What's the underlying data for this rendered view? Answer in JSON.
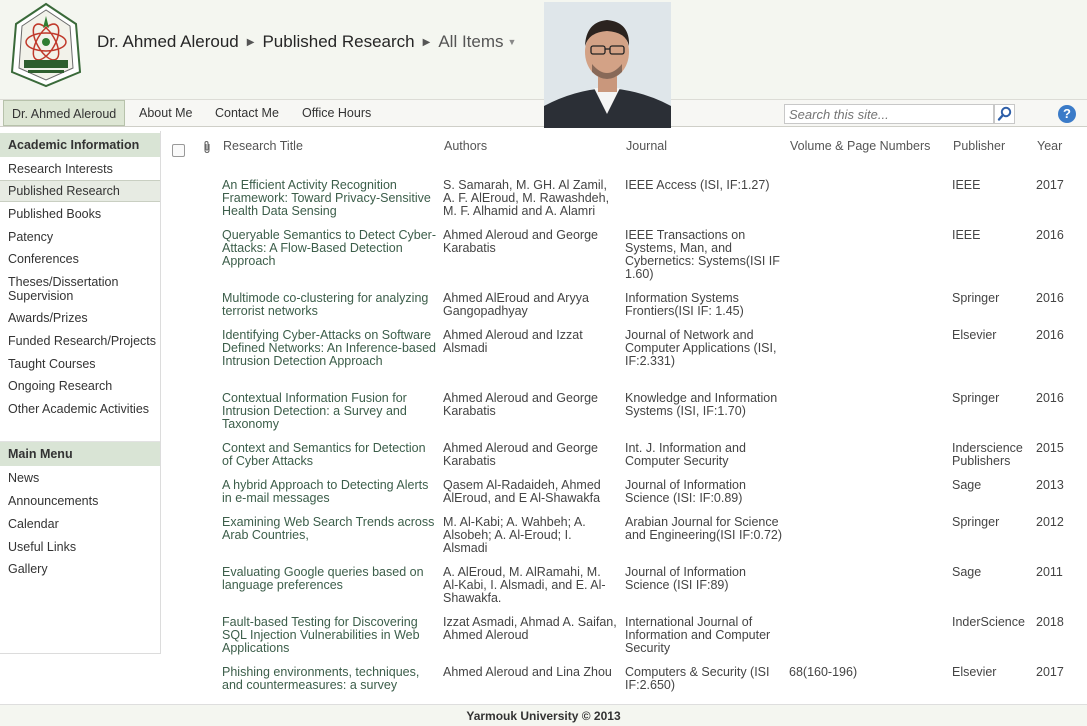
{
  "header": {
    "breadcrumb": [
      "Dr. Ahmed Aleroud",
      "Published Research",
      "All Items"
    ]
  },
  "topnav": {
    "items": [
      "Dr. Ahmed Aleroud",
      "About Me",
      "Contact Me",
      "Office Hours"
    ],
    "selected": "Dr. Ahmed Aleroud",
    "search_placeholder": "Search this site...",
    "help_label": "?"
  },
  "sidebar": {
    "sections": [
      {
        "heading": "Academic Information",
        "items": [
          "Research Interests",
          "Published Research",
          "Published Books",
          "Patency",
          "Conferences",
          "Theses/Dissertation Supervision",
          "Awards/Prizes",
          "Funded Research/Projects",
          "Taught Courses",
          "Ongoing Research",
          "Other Academic Activities"
        ]
      },
      {
        "heading": "Main Menu",
        "items": [
          "News",
          "Announcements",
          "Calendar",
          "Useful Links",
          "Gallery"
        ]
      }
    ],
    "selected": "Published Research"
  },
  "table": {
    "columns": [
      "Research Title",
      "Authors",
      "Journal",
      "Volume & Page Numbers",
      "Publisher",
      "Year"
    ],
    "rows": [
      {
        "title": "An Efficient Activity Recognition Framework: Toward Privacy-Sensitive Health Data Sensing",
        "authors": "S. Samarah, M. GH. Al Zamil, A. F. AlEroud, M. Rawashdeh, M. F. Alhamid and A. Alamri",
        "journal": "IEEE Access (ISI, IF:1.27)",
        "volume": "",
        "publisher": "IEEE",
        "year": "2017"
      },
      {
        "title": "Queryable Semantics to Detect Cyber-Attacks: A Flow-Based Detection Approach",
        "authors": "Ahmed Aleroud and George Karabatis",
        "journal": "IEEE Transactions on Systems, Man, and Cybernetics: Systems(ISI IF 1.60)",
        "volume": "",
        "publisher": "IEEE",
        "year": "2016"
      },
      {
        "title": "Multimode co-clustering for analyzing terrorist networks",
        "authors": "Ahmed AlEroud and Aryya Gangopadhyay",
        "journal": "Information Systems Frontiers(ISI IF: 1.45)",
        "volume": "",
        "publisher": "Springer",
        "year": "2016"
      },
      {
        "title": "Identifying Cyber-Attacks on Software Defined Networks: An Inference-based Intrusion Detection Approach",
        "authors": "Ahmed Aleroud and Izzat Alsmadi",
        "journal": "Journal of Network and Computer Applications (ISI, IF:2.331)",
        "volume": "",
        "publisher": "Elsevier",
        "year": "2016"
      },
      {
        "title": "Contextual Information Fusion for Intrusion Detection: a Survey and Taxonomy",
        "authors": "Ahmed Aleroud and George Karabatis",
        "journal": "Knowledge and Information Systems (ISI, IF:1.70)",
        "volume": "",
        "publisher": "Springer",
        "year": "2016"
      },
      {
        "title": "Context and Semantics for Detection of Cyber Attacks",
        "authors": "Ahmed Aleroud and George Karabatis",
        "journal": "Int. J. Information and Computer Security",
        "volume": "",
        "publisher": "Inderscience Publishers",
        "year": "2015"
      },
      {
        "title": "A hybrid Approach to Detecting Alerts in e-mail messages",
        "authors": "Qasem Al-Radaideh, Ahmed AlEroud, and E Al-Shawakfa",
        "journal": "Journal of Information Science (ISI: IF:0.89)",
        "volume": "",
        "publisher": "Sage",
        "year": "2013"
      },
      {
        "title": "Examining Web Search Trends across Arab Countries,",
        "authors": "M. Al-Kabi; A. Wahbeh; A. Alsobeh; A. Al-Eroud; I. Alsmadi",
        "journal": "Arabian Journal for Science and Engineering(ISI IF:0.72)",
        "volume": "",
        "publisher": "Springer",
        "year": "2012"
      },
      {
        "title": "Evaluating Google queries based on language preferences",
        "authors": "A. AlEroud, M. AlRamahi, M. Al-Kabi, I. Alsmadi, and E. Al-Shawakfa.",
        "journal": "Journal of Information Science (ISI IF:89)",
        "volume": "",
        "publisher": "Sage",
        "year": "2011"
      },
      {
        "title": "Fault-based Testing for Discovering SQL Injection Vulnerabilities in Web Applications",
        "authors": "Izzat Asmadi, Ahmad A. Saifan,  Ahmed Aleroud",
        "journal": "International Journal of Information and Computer Security",
        "volume": "",
        "publisher": "InderScience",
        "year": "2018"
      },
      {
        "title": "Phishing environments, techniques, and countermeasures: a survey",
        "authors": "Ahmed Aleroud and Lina Zhou",
        "journal": "Computers & Security (ISI IF:2.650)",
        "volume": "68(160-196)",
        "publisher": "Elsevier",
        "year": "2017"
      }
    ]
  },
  "footer": {
    "text": "Yarmouk University © 2013"
  },
  "colors": {
    "header_bg": "#f4f6f0",
    "sidebar_heading_bg": "#d9e4d5",
    "link_green": "#3c5e4a",
    "help_blue": "#3b7bc8"
  }
}
